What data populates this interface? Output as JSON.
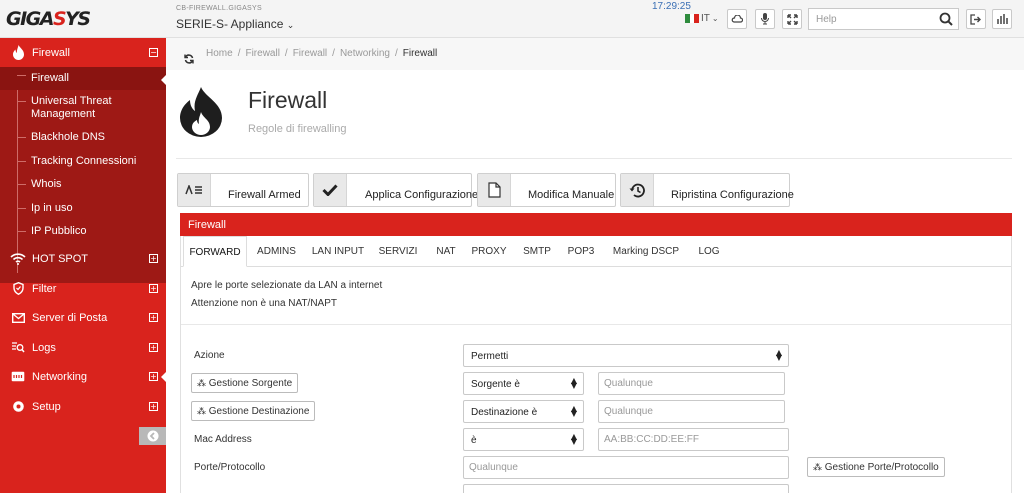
{
  "header": {
    "logo_text": "GIGASYS",
    "appliance_small": "CB-FIREWALL.GIGASYS",
    "appliance_name": "SERIE-S- Appliance",
    "clock": "17:29:25",
    "language": "IT",
    "help_placeholder": "Help",
    "icons": [
      "cloud-icon",
      "microphone-icon",
      "fullscreen-icon",
      "search-icon",
      "logout-icon",
      "network-icon"
    ]
  },
  "sidebar": {
    "firewall": {
      "label": "Firewall",
      "items": [
        "Firewall",
        "Universal Threat Management",
        "Blackhole DNS",
        "Tracking Connessioni",
        "Whois",
        "Ip in uso",
        "IP Pubblico"
      ]
    },
    "sections": [
      "HOT SPOT",
      "Filter",
      "Server di Posta",
      "Logs",
      "Networking",
      "Setup"
    ]
  },
  "breadcrumb": [
    "Home",
    "Firewall",
    "Firewall",
    "Networking",
    "Firewall"
  ],
  "page": {
    "title": "Firewall",
    "subtitle": "Regole di firewalling"
  },
  "actions": [
    "Firewall Armed",
    "Applica Configurazione",
    "Modifica Manuale",
    "Ripristina Configurazione"
  ],
  "panel": {
    "title": "Firewall",
    "tabs": [
      "FORWARD",
      "ADMINS",
      "LAN INPUT",
      "SERVIZI",
      "NAT",
      "PROXY",
      "SMTP",
      "POP3",
      "Marking DSCP",
      "LOG"
    ],
    "active_tab": "FORWARD",
    "info_line1": "Apre le porte selezionate da LAN a internet",
    "info_line2": "Attenzione non è una NAT/NAPT"
  },
  "form": {
    "azione_label": "Azione",
    "azione_value": "Permetti",
    "gestione_sorgente": "Gestione Sorgente",
    "sorgente_op": "Sorgente è",
    "sorgente_placeholder": "Qualunque",
    "gestione_destinazione": "Gestione Destinazione",
    "destinazione_op": "Destinazione è",
    "destinazione_placeholder": "Qualunque",
    "mac_label": "Mac Address",
    "mac_op": "è",
    "mac_placeholder": "AA:BB:CC:DD:EE:FF",
    "porte_label": "Porte/Protocollo",
    "porte_placeholder": "Qualunque",
    "gestione_porte": "Gestione Porte/Protocollo"
  },
  "colors": {
    "brand_red": "#d9231d",
    "sidebar_sub": "#9e1915"
  }
}
